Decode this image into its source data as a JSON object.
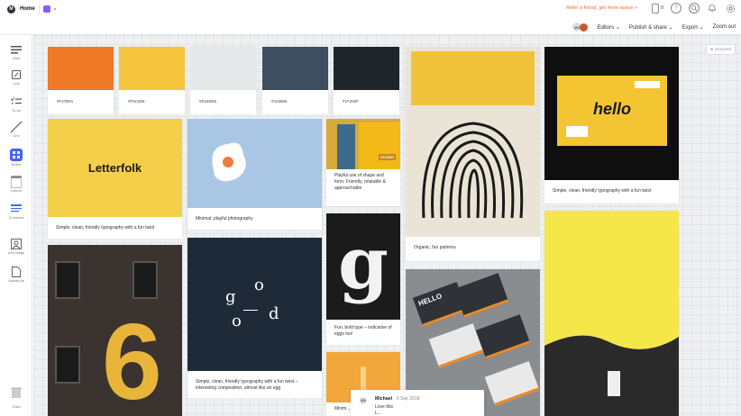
{
  "header": {
    "home_label": "Home",
    "refer_text": "Refer a friend, get more space »",
    "online_count": "0",
    "help_icon": "question-icon",
    "avatar_initials": "MW",
    "editors_label": "Editors",
    "publish_label": "Publish & share",
    "export_label": "Export",
    "zoom_label": "Zoom out"
  },
  "sidebar": {
    "tools": [
      {
        "label": "Note",
        "icon": "note-icon"
      },
      {
        "label": "Link",
        "icon": "link-icon"
      },
      {
        "label": "To-do",
        "icon": "todo-icon"
      },
      {
        "label": "Line",
        "icon": "line-icon"
      },
      {
        "label": "Board",
        "icon": "board-icon"
      },
      {
        "label": "Column",
        "icon": "column-icon"
      },
      {
        "label": "Comment",
        "icon": "comment-icon"
      },
      {
        "label": "Add image",
        "icon": "image-icon"
      },
      {
        "label": "Upload file",
        "icon": "file-icon"
      }
    ],
    "trash_label": "Trash"
  },
  "canvas": {
    "unsorted_label": "Unsorted",
    "swatches": [
      {
        "hex": "#F27B01",
        "color": "#ee7a27"
      },
      {
        "hex": "#F6C506",
        "color": "#f4c43c"
      },
      {
        "hex": "#E1E6E6",
        "color": "#e6e9e9"
      },
      {
        "hex": "#415566",
        "color": "#3f4e5e"
      },
      {
        "hex": "#1F292F",
        "color": "#1f262c"
      }
    ],
    "letterfolk_logo": "Letterfolk",
    "hello_text": "hello",
    "good_letters": [
      "g",
      "o",
      "o",
      "d"
    ],
    "g_letter": "g",
    "studio_sign": "STUDIO",
    "number_six": "6",
    "hello_cards": "HELLO",
    "captions": {
      "letterfolk": "Simple, clean, friendly typography with a fun twist",
      "egg": "Minimal, playful photography",
      "studio": "Playful use of shape and form. Friendly, relatable & approachable",
      "patterns": "Organic, fun patterns",
      "hello": "Simple, clean, friendly typography with a fun twist",
      "good": "Simple, clean, friendly typography with a fun twist – interesting composition, almost like an egg",
      "g": "Fun, bold type – indicative of eggs too!",
      "minimal": "Minim..."
    },
    "comment": {
      "initials": "MW",
      "author": "Michael",
      "date": "6 Sep 2018",
      "text": "Love this",
      "more": "L..."
    }
  }
}
